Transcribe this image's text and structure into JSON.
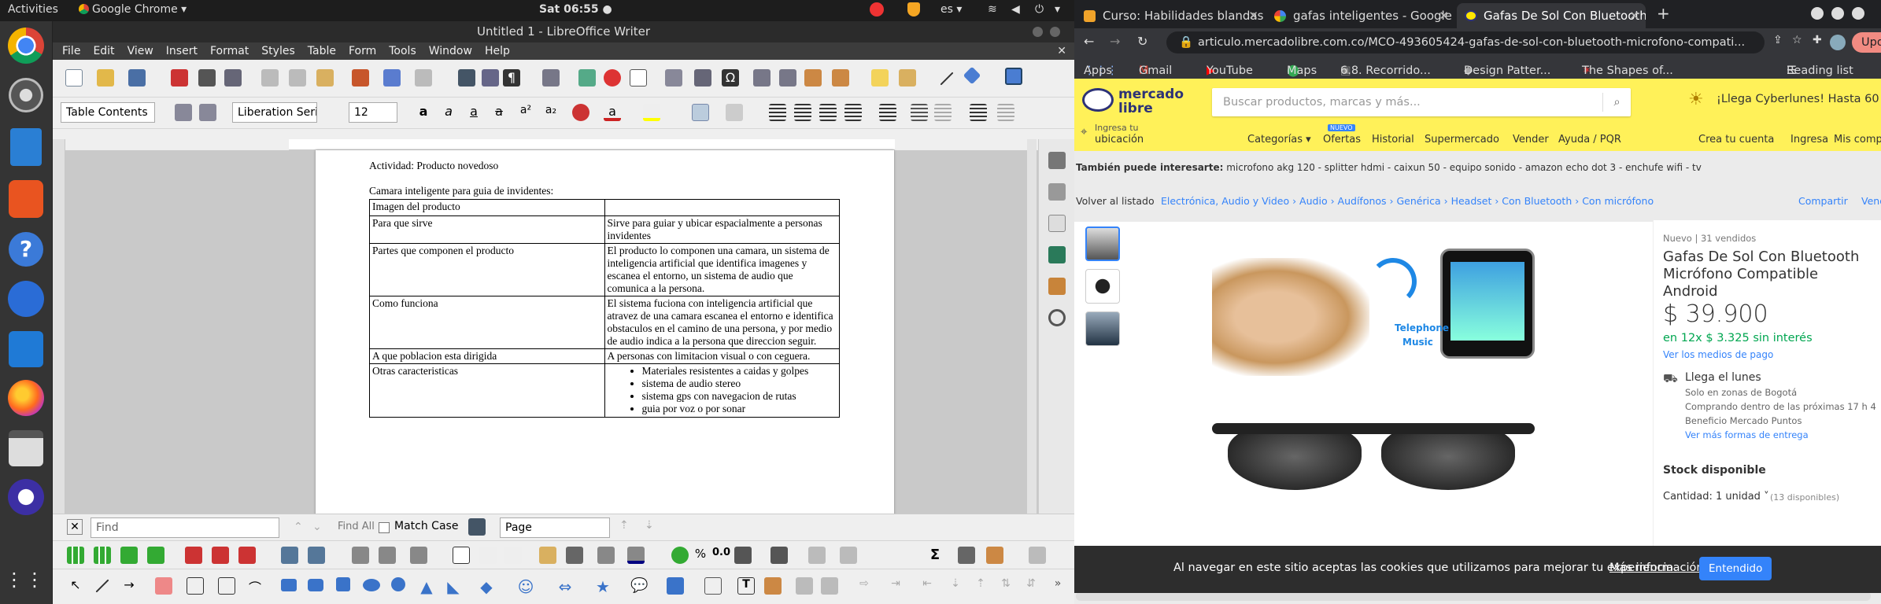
{
  "topbar": {
    "activities": "Activities",
    "app": "Google Chrome ▾",
    "clock": "Sat 06:55 ●",
    "lang": "es ▾"
  },
  "writer": {
    "title": "Untitled 1 - LibreOffice Writer",
    "menu": [
      "File",
      "Edit",
      "View",
      "Insert",
      "Format",
      "Styles",
      "Table",
      "Form",
      "Tools",
      "Window",
      "Help"
    ],
    "para_style": "Table Contents",
    "font_name": "Liberation Seri",
    "font_size": "12",
    "doc": {
      "line1": "Actividad: Producto novedoso",
      "line2": "Camara inteligente para guia de invidentes:",
      "rows": [
        {
          "left": "Imagen del producto",
          "right": ""
        },
        {
          "left": "Para que sirve",
          "right": "Sirve para guiar y ubicar espacialmente a personas invidentes"
        },
        {
          "left": "Partes que componen el producto",
          "right": "El producto lo componen una camara, un sistema de inteligencia artificial que identifica imagenes y escanea el entorno, un sistema de audio que comunica a la persona."
        },
        {
          "left": "Como funciona",
          "right": "El sistema fuciona con inteligencia artificial que atravez de una camara escanea el entorno e identifica obstaculos en el camino de una persona, y por medio de audio indica a la persona que direccion seguir."
        },
        {
          "left": "A que poblacion esta dirigida",
          "right": "A personas con limitacion visual o con ceguera."
        },
        {
          "left": "Otras caracteristicas",
          "list": [
            "Materiales resistentes a caidas y golpes",
            "sistema de audio stereo",
            "sistema gps con navegacion de rutas",
            "guia por voz o por sonar"
          ]
        }
      ]
    },
    "find": {
      "placeholder": "Find",
      "findall": "Find All",
      "matchcase": "Match Case",
      "page": "Page"
    }
  },
  "chrome": {
    "tabs": [
      "Curso: Habilidades blandas",
      "gafas inteligentes - Google",
      "Gafas De Sol Con Bluetooth"
    ],
    "url": "articulo.mercadolibre.com.co/MCO-493605424-gafas-de-sol-con-bluetooth-microfono-compati...",
    "update": "Update",
    "bookmarks": [
      "Apps",
      "Gmail",
      "YouTube",
      "Maps",
      "6.8. Recorrido...",
      "Design Patter...",
      "The Shapes of..."
    ],
    "reading": "Reading list",
    "ml": {
      "logo1": "mercado",
      "logo2": "libre",
      "search_ph": "Buscar productos, marcas y más...",
      "promo": "¡Llega Cyberlunes! Hasta 60",
      "loc1": "Ingresa tu",
      "loc2": "ubicación",
      "nav": [
        "Categorías ▾",
        "Ofertas",
        "Historial",
        "Supermercado",
        "Vender",
        "Ayuda / PQR"
      ],
      "nuevo": "NUEVO",
      "right_nav": [
        "Crea tu cuenta",
        "Ingresa",
        "Mis compr"
      ],
      "interest_label": "También puede interesarte:",
      "interest": "microfono akg 120 - splitter hdmi - caixun 50 - equipo sonido - amazon echo dot 3 - enchufe wifi - tv",
      "back": "Volver al listado",
      "crumbs": "Electrónica, Audio y Video  ›  Audio  ›  Audífonos  ›  Genérica  ›  Headset  ›  Con Bluetooth  ›  Con micrófono",
      "share": "Compartir",
      "sell": "Vende",
      "cond": "Nuevo  |  31 vendidos",
      "ptitle": "Gafas De Sol Con Bluetooth Micrófono Compatible Android",
      "price": "$ 39.900",
      "inst": "en 12x $ 3.325 sin interés",
      "means": "Ver los medios de pago",
      "ship1": "Llega el lunes",
      "ship2": "Solo en zonas de Bogotá",
      "ship3": "Comprando dentro de las próximas 17 h 4",
      "ship4": "Beneficio Mercado Puntos",
      "ship5": "Ver más formas de entrega",
      "stock": "Stock disponible",
      "qty": "Cantidad: 1 unidad ˅",
      "qty2": "(13 disponibles)",
      "img_tel": "Telephone",
      "img_music": "Music",
      "cookie": "Al navegar en este sitio aceptas las cookies que utilizamos para mejorar tu experiencia.",
      "more": "Más información.",
      "ok": "Entendido"
    }
  }
}
